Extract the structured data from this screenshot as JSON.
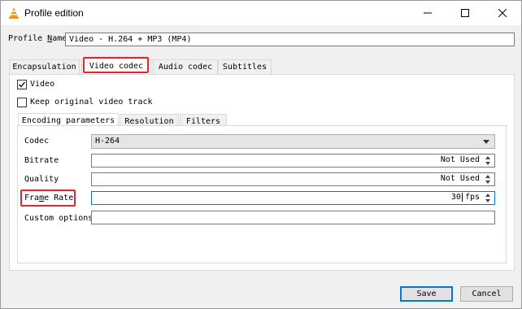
{
  "window": {
    "title": "Profile edition",
    "icon": "vlc-cone-icon"
  },
  "profile": {
    "name_label_pre": "Profile ",
    "name_label_u": "N",
    "name_label_post": "ame",
    "name_value": "Video - H.264 + MP3 (MP4)"
  },
  "tabs": [
    {
      "label": "Encapsulation"
    },
    {
      "label": "Video codec"
    },
    {
      "label": "Audio codec"
    },
    {
      "label": "Subtitles"
    }
  ],
  "video": {
    "video_label": "Video",
    "video_checked": true,
    "keep_label": "Keep original video track",
    "keep_checked": false
  },
  "subtabs": [
    {
      "label": "Encoding parameters"
    },
    {
      "label": "Resolution"
    },
    {
      "label": "Filters"
    }
  ],
  "params": {
    "codec_label": "Codec",
    "codec_value": "H-264",
    "bitrate_label": "Bitrate",
    "bitrate_value": "Not Used",
    "quality_label": "Quality",
    "quality_value": "Not Used",
    "framerate_label_pre": "Fra",
    "framerate_label_u": "m",
    "framerate_label_post": "e Rate",
    "framerate_value": "30",
    "framerate_unit": "fps",
    "custom_label": "Custom options",
    "custom_value": ""
  },
  "buttons": {
    "save": "Save",
    "cancel": "Cancel"
  },
  "colors": {
    "highlight": "#e8262a",
    "focus": "#0078d7"
  }
}
